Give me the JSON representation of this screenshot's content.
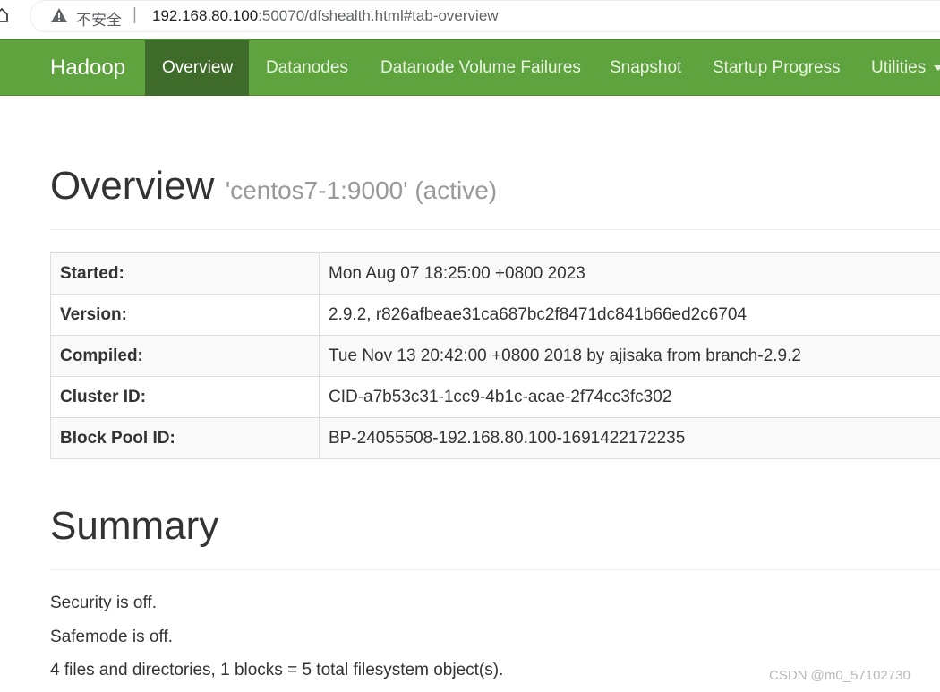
{
  "browser": {
    "security_label": "不安全",
    "separator": "|",
    "url_host": "192.168.80.100",
    "url_rest": ":50070/dfshealth.html#tab-overview"
  },
  "navbar": {
    "brand": "Hadoop",
    "items": [
      {
        "label": "Overview",
        "active": true
      },
      {
        "label": "Datanodes"
      },
      {
        "label": "Datanode Volume Failures"
      },
      {
        "label": "Snapshot"
      },
      {
        "label": "Startup Progress"
      },
      {
        "label": "Utilities"
      }
    ],
    "active_color": "#3f6b2a",
    "bar_color": "#5fa33e"
  },
  "overview": {
    "title": "Overview",
    "subtitle": "'centos7-1:9000' (active)",
    "rows": [
      {
        "key": "Started:",
        "value": "Mon Aug 07 18:25:00 +0800 2023"
      },
      {
        "key": "Version:",
        "value": "2.9.2, r826afbeae31ca687bc2f8471dc841b66ed2c6704"
      },
      {
        "key": "Compiled:",
        "value": "Tue Nov 13 20:42:00 +0800 2018 by ajisaka from branch-2.9.2"
      },
      {
        "key": "Cluster ID:",
        "value": "CID-a7b53c31-1cc9-4b1c-acae-2f74cc3fc302"
      },
      {
        "key": "Block Pool ID:",
        "value": "BP-24055508-192.168.80.100-1691422172235"
      }
    ]
  },
  "summary": {
    "title": "Summary",
    "lines": [
      "Security is off.",
      "Safemode is off.",
      "4 files and directories, 1 blocks = 5 total filesystem object(s)."
    ]
  },
  "watermark": "CSDN @m0_57102730"
}
